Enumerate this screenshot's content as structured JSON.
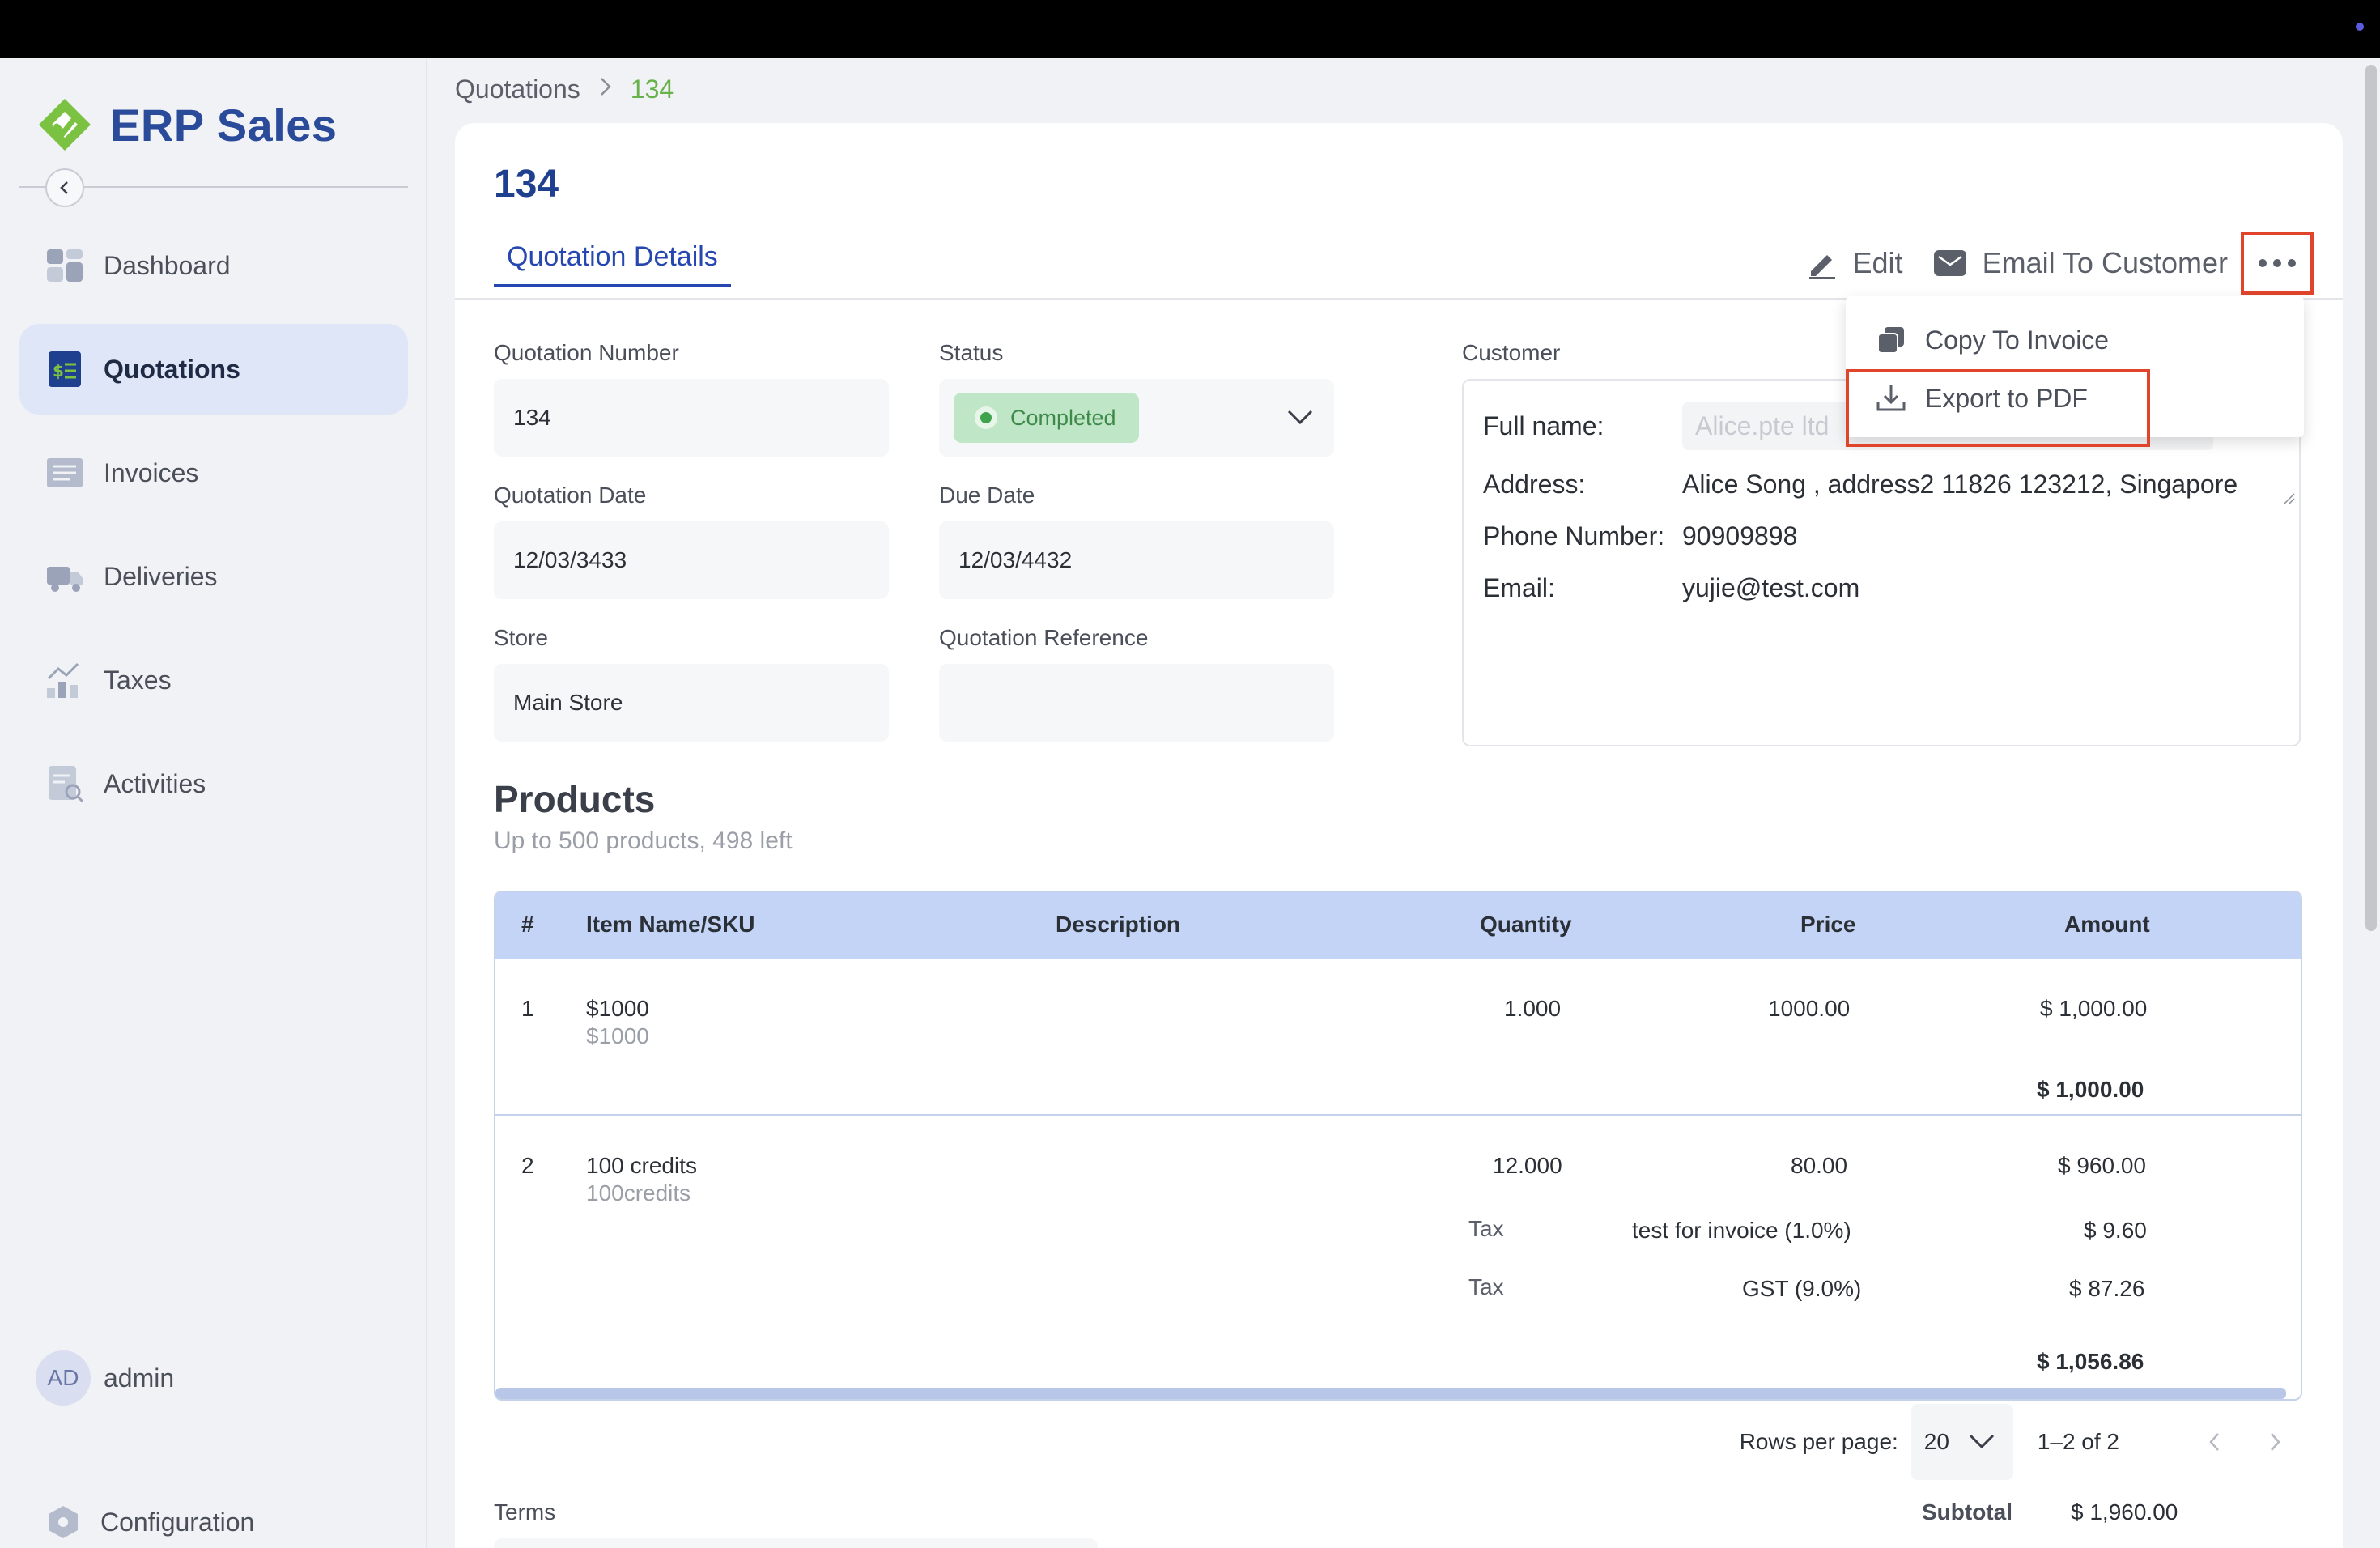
{
  "app": {
    "name": "ERP Sales"
  },
  "sidebar": {
    "items": [
      {
        "label": "Dashboard",
        "icon": "dashboard-icon"
      },
      {
        "label": "Quotations",
        "icon": "quotation-icon",
        "active": true
      },
      {
        "label": "Invoices",
        "icon": "invoice-icon"
      },
      {
        "label": "Deliveries",
        "icon": "truck-icon"
      },
      {
        "label": "Taxes",
        "icon": "tax-chart-icon"
      },
      {
        "label": "Activities",
        "icon": "activities-icon"
      }
    ],
    "user": {
      "initials": "AD",
      "name": "admin"
    },
    "configuration": "Configuration"
  },
  "breadcrumb": {
    "root": "Quotations",
    "current": "134"
  },
  "page": {
    "title": "134"
  },
  "tabs": {
    "details": "Quotation Details"
  },
  "actions": {
    "edit": "Edit",
    "email": "Email To Customer"
  },
  "menu": {
    "copy_to_invoice": "Copy To Invoice",
    "export_pdf": "Export to PDF"
  },
  "form": {
    "quotation_number": {
      "label": "Quotation Number",
      "value": "134"
    },
    "status": {
      "label": "Status",
      "value": "Completed"
    },
    "quotation_date": {
      "label": "Quotation Date",
      "value": "12/03/3433"
    },
    "due_date": {
      "label": "Due Date",
      "value": "12/03/4432"
    },
    "store": {
      "label": "Store",
      "value": "Main Store"
    },
    "quotation_reference": {
      "label": "Quotation Reference",
      "value": ""
    }
  },
  "customer": {
    "label": "Customer",
    "full_name_label": "Full name:",
    "full_name_placeholder": "Alice.pte ltd",
    "address_label": "Address:",
    "address": "Alice Song , address2 11826 123212, Singapore",
    "phone_label": "Phone Number:",
    "phone": "90909898",
    "email_label": "Email:",
    "email": "yujie@test.com"
  },
  "products": {
    "title": "Products",
    "subtitle": "Up to 500 products, 498 left",
    "columns": [
      "#",
      "Item Name/SKU",
      "Description",
      "Quantity",
      "Price",
      "Amount"
    ],
    "rows": [
      {
        "num": "1",
        "name": "$1000",
        "sku": "$1000",
        "quantity": "1.000",
        "price": "1000.00",
        "amount": "$ 1,000.00",
        "total": "$ 1,000.00",
        "taxes": []
      },
      {
        "num": "2",
        "name": "100 credits",
        "sku": "100credits",
        "quantity": "12.000",
        "price": "80.00",
        "amount": "$ 960.00",
        "total": "$ 1,056.86",
        "taxes": [
          {
            "label": "Tax",
            "name": "test for invoice (1.0%)",
            "amount": "$ 9.60"
          },
          {
            "label": "Tax",
            "name": "GST (9.0%)",
            "amount": "$ 87.26"
          }
        ]
      }
    ]
  },
  "pagination": {
    "rows_per_page_label": "Rows per page:",
    "rows_per_page": "20",
    "range": "1–2 of 2"
  },
  "terms": {
    "label": "Terms"
  },
  "summary": {
    "subtotal_label": "Subtotal",
    "subtotal": "$ 1,960.00"
  },
  "colors": {
    "brand": "#2a4a9a",
    "accent_green": "#67b34a",
    "highlight_red": "#e0452b",
    "table_header": "#c4d4f6"
  }
}
